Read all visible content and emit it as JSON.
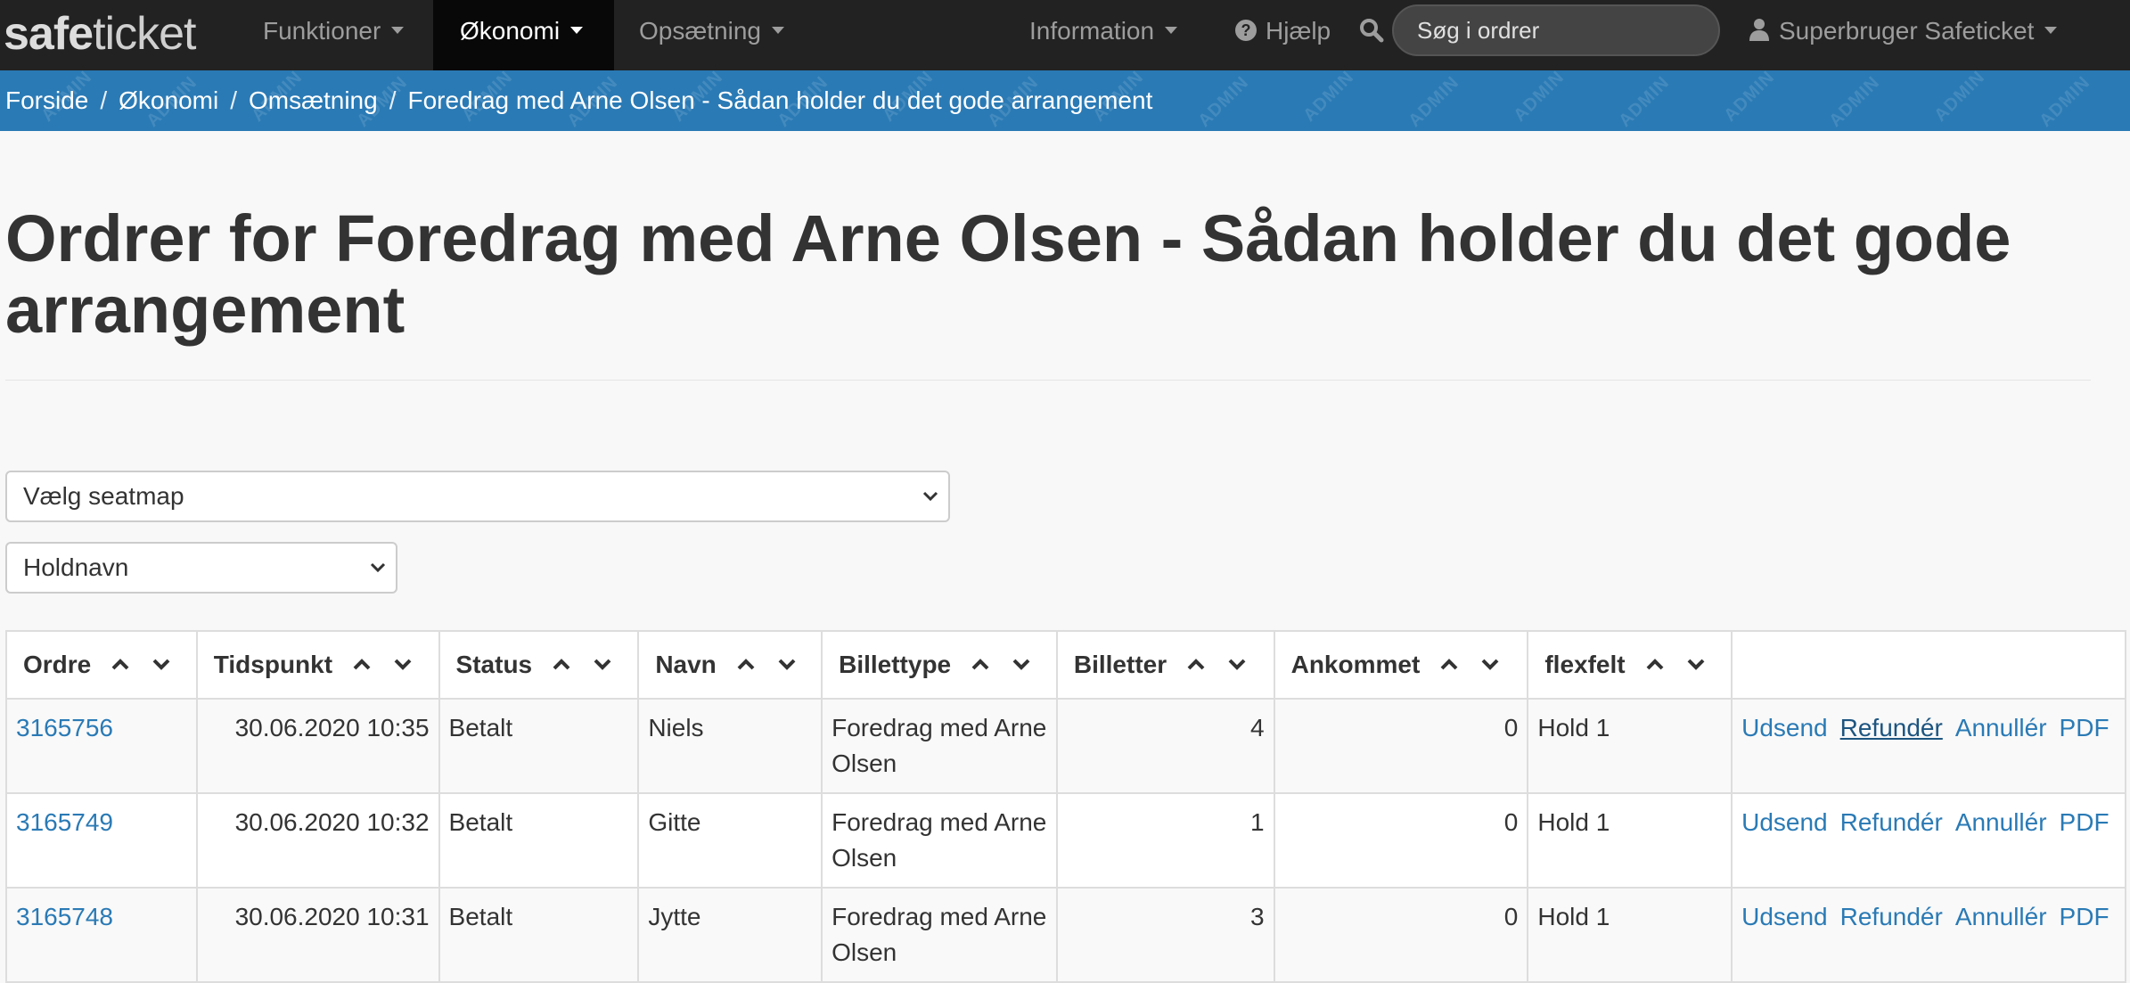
{
  "brand": {
    "bold": "safe",
    "light": "ticket"
  },
  "nav": {
    "functions": "Funktioner",
    "economy": "Økonomi",
    "setup": "Opsætning",
    "information": "Information",
    "help": "Hjælp",
    "search_placeholder": "Søg i ordrer",
    "user": "Superbruger Safeticket"
  },
  "breadcrumb": [
    "Forside",
    "Økonomi",
    "Omsætning",
    "Foredrag med Arne Olsen - Sådan holder du det gode arrangement"
  ],
  "watermark": "ADMIN",
  "title": "Ordrer for Foredrag med Arne Olsen - Sådan holder du det gode arrangement",
  "filters": {
    "seatmap": "Vælg seatmap",
    "team": "Holdnavn"
  },
  "table": {
    "headers": [
      "Ordre",
      "Tidspunkt",
      "Status",
      "Navn",
      "Billettype",
      "Billetter",
      "Ankommet",
      "flexfelt"
    ],
    "rows": [
      {
        "order": "3165756",
        "time": "30.06.2020 10:35",
        "status": "Betalt",
        "name": "Niels",
        "type": "Foredrag med Arne Olsen",
        "tickets": "4",
        "arrived": "0",
        "flex": "Hold 1"
      },
      {
        "order": "3165749",
        "time": "30.06.2020 10:32",
        "status": "Betalt",
        "name": "Gitte",
        "type": "Foredrag med Arne Olsen",
        "tickets": "1",
        "arrived": "0",
        "flex": "Hold 1"
      },
      {
        "order": "3165748",
        "time": "30.06.2020 10:31",
        "status": "Betalt",
        "name": "Jytte",
        "type": "Foredrag med Arne Olsen",
        "tickets": "3",
        "arrived": "0",
        "flex": "Hold 1"
      }
    ],
    "actions": [
      "Udsend",
      "Refundér",
      "Annullér",
      "PDF"
    ]
  },
  "colors": {
    "navbar": "#222222",
    "breadcrumb": "#2a7ab5",
    "link": "#2a7ab5"
  }
}
